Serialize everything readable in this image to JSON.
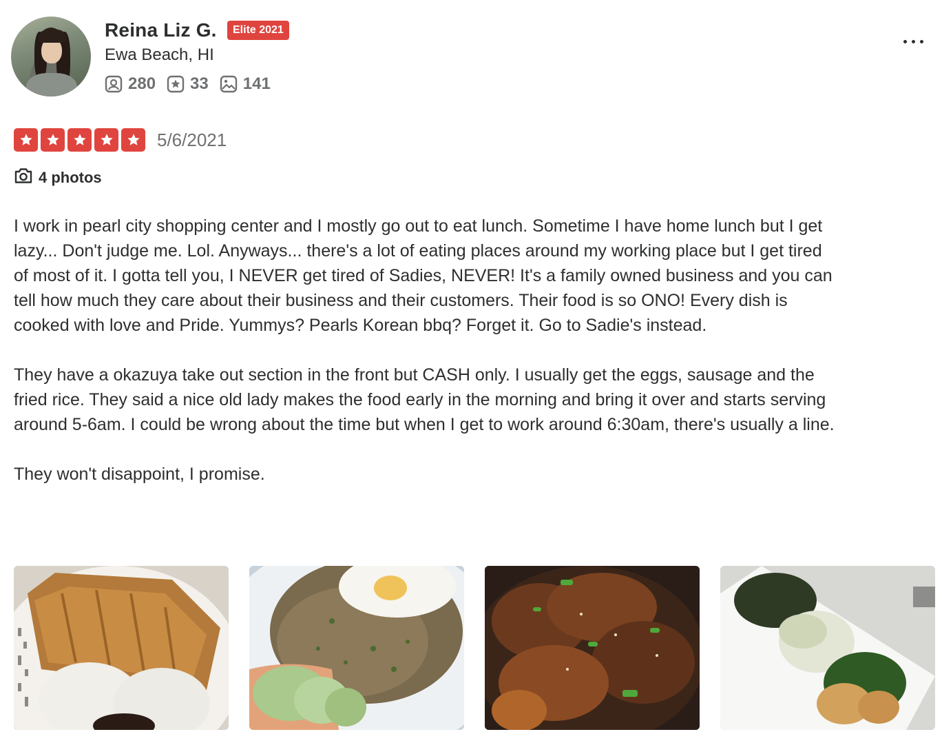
{
  "user": {
    "name": "Reina Liz G.",
    "badge": "Elite 2021",
    "location": "Ewa Beach, HI",
    "stats": {
      "friends": "280",
      "reviews": "33",
      "photos": "141"
    }
  },
  "review": {
    "rating": 5,
    "date": "5/6/2021",
    "photos_label": "4 photos",
    "paragraphs": [
      "I work in pearl city shopping center and I mostly go out to eat lunch. Sometime I have home lunch but I get lazy... Don't judge me. Lol. Anyways... there's a lot of eating places around my working place but I get tired of most of it. I gotta tell you, I NEVER get tired of Sadies, NEVER! It's a family owned business and you can tell how much they care about their business and their customers. Their food is so ONO! Every dish is cooked with love and Pride. Yummys? Pearls Korean bbq? Forget it. Go to Sadie's instead.",
      "They have a okazuya take out section in the front but CASH only. I usually get the eggs, sausage and the fried rice. They said a nice old lady makes the food early in the morning and bring it over and starts serving around 5-6am. I could be wrong about the time but when I get to work around 6:30am, there's usually a line.",
      "They won't disappoint, I promise."
    ]
  },
  "colors": {
    "accent_red": "#e0443e",
    "text": "#2d2e2f",
    "muted": "#6e7072"
  }
}
